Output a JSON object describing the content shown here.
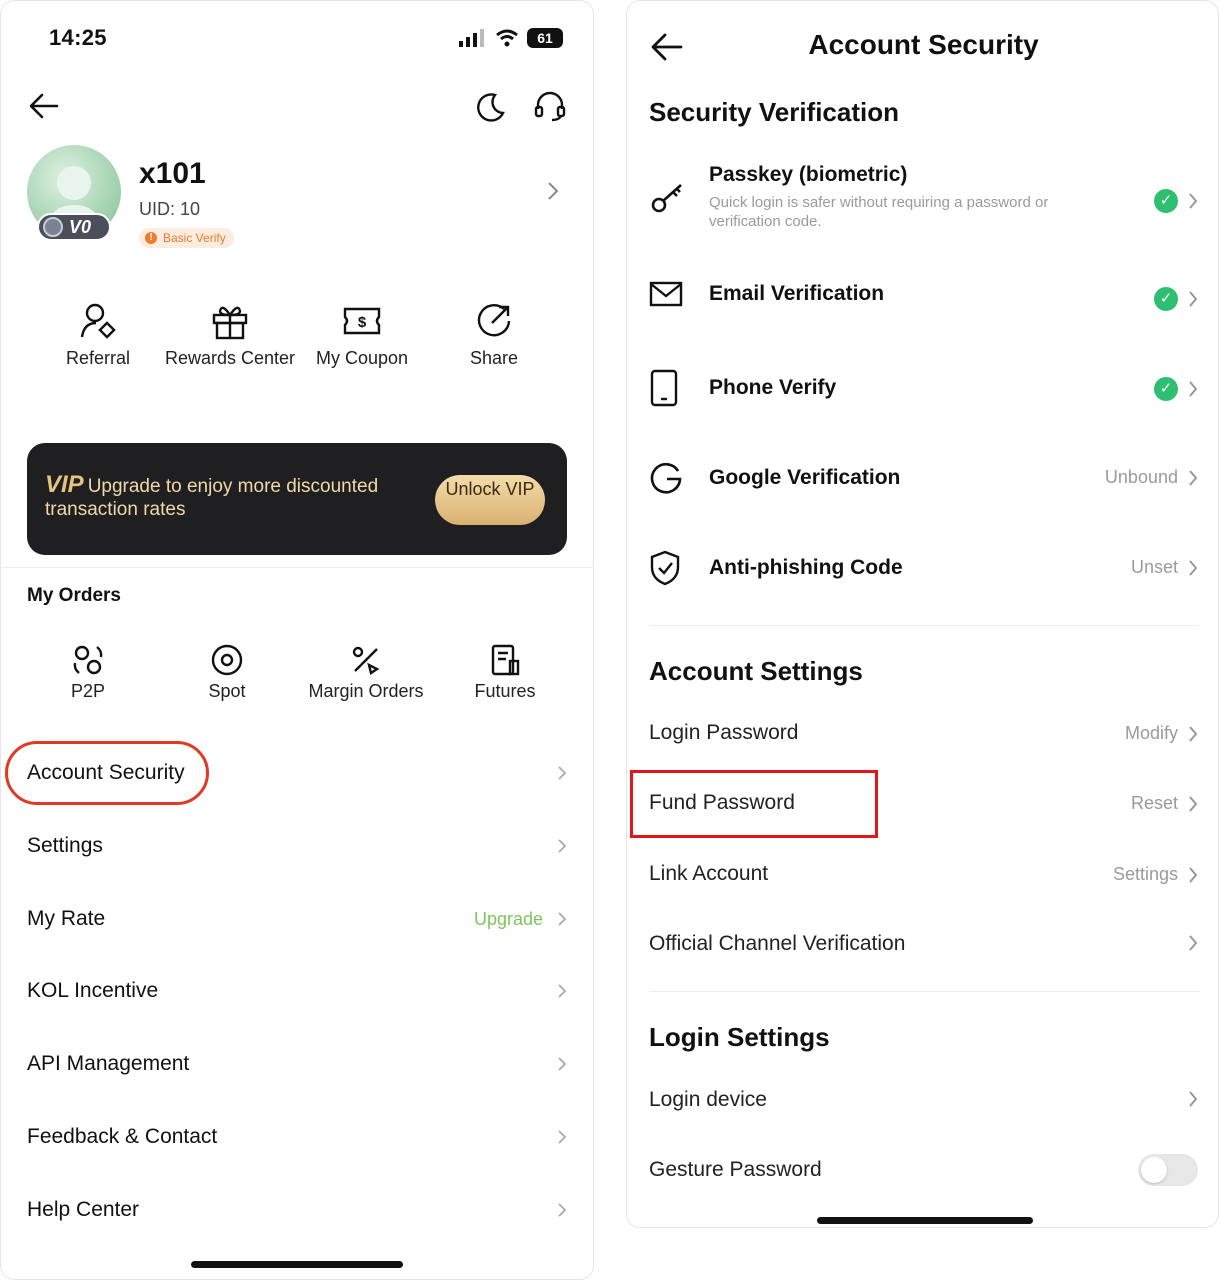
{
  "left_screen": {
    "status": {
      "time": "14:25",
      "battery": "61"
    },
    "profile": {
      "username": "x101",
      "uid": "UID: 10",
      "vip_level": "V0",
      "verify_badge": "Basic Verify"
    },
    "quick_actions": [
      {
        "label": "Referral",
        "icon": "referral-icon"
      },
      {
        "label": "Rewards Center",
        "icon": "gift-icon"
      },
      {
        "label": "My Coupon",
        "icon": "coupon-icon"
      },
      {
        "label": "Share",
        "icon": "share-icon"
      }
    ],
    "vip_banner": {
      "vip": "VIP",
      "text": "Upgrade to enjoy more discounted transaction rates",
      "button": "Unlock VIP"
    },
    "orders": {
      "title": "My Orders",
      "items": [
        {
          "label": "P2P"
        },
        {
          "label": "Spot"
        },
        {
          "label": "Margin Orders"
        },
        {
          "label": "Futures"
        }
      ]
    },
    "menu": [
      {
        "label": "Account Security",
        "extra": ""
      },
      {
        "label": "Settings",
        "extra": ""
      },
      {
        "label": "My Rate",
        "extra": "Upgrade"
      },
      {
        "label": "KOL Incentive",
        "extra": ""
      },
      {
        "label": "API Management",
        "extra": ""
      },
      {
        "label": "Feedback & Contact",
        "extra": ""
      },
      {
        "label": "Help Center",
        "extra": ""
      }
    ]
  },
  "right_screen": {
    "title": "Account Security",
    "security_verification": {
      "title": "Security Verification",
      "items": [
        {
          "name": "Passkey (biometric)",
          "desc": "Quick login is safer without requiring a password or verification code.",
          "status": "verified"
        },
        {
          "name": "Email Verification",
          "status": "verified"
        },
        {
          "name": "Phone Verify",
          "status": "verified"
        },
        {
          "name": "Google Verification",
          "status_text": "Unbound"
        },
        {
          "name": "Anti-phishing Code",
          "status_text": "Unset"
        }
      ]
    },
    "account_settings": {
      "title": "Account Settings",
      "items": [
        {
          "name": "Login Password",
          "action": "Modify"
        },
        {
          "name": "Fund Password",
          "action": "Reset"
        },
        {
          "name": "Link Account",
          "action": "Settings"
        },
        {
          "name": "Official Channel Verification",
          "action": ""
        }
      ]
    },
    "login_settings": {
      "title": "Login Settings",
      "items": [
        {
          "name": "Login device"
        },
        {
          "name": "Gesture Password",
          "toggle": false
        }
      ]
    }
  },
  "colors": {
    "accent_green": "#2fbf71",
    "upgrade_green": "#7ec45c",
    "highlight_red": "#e0161c",
    "badge_orange": "#ee7c2b"
  }
}
